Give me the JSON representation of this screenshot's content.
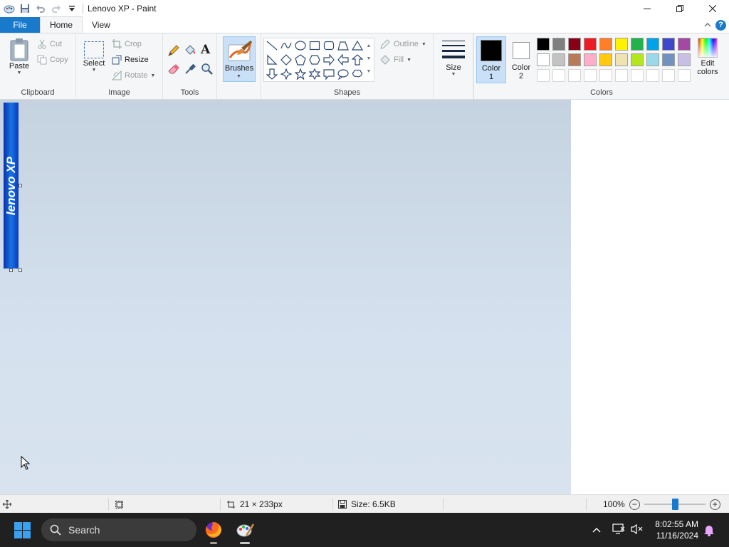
{
  "window": {
    "title": "Lenovo XP - Paint"
  },
  "tabs": {
    "file": "File",
    "home": "Home",
    "view": "View"
  },
  "ribbon": {
    "clipboard": {
      "label": "Clipboard",
      "paste": "Paste",
      "cut": "Cut",
      "copy": "Copy"
    },
    "image": {
      "label": "Image",
      "select": "Select",
      "crop": "Crop",
      "resize": "Resize",
      "rotate": "Rotate"
    },
    "tools": {
      "label": "Tools"
    },
    "brushes": {
      "label": "Brushes"
    },
    "shapes": {
      "label": "Shapes",
      "outline": "Outline",
      "fill": "Fill"
    },
    "size": {
      "label": "Size"
    },
    "color1": {
      "label": "Color",
      "num": "1"
    },
    "color2": {
      "label": "Color",
      "num": "2"
    },
    "colors": {
      "label": "Colors",
      "edit1": "Edit",
      "edit2": "colors",
      "row1": [
        "#000000",
        "#7f7f7f",
        "#880015",
        "#ed1c24",
        "#ff7f27",
        "#fff200",
        "#22b14c",
        "#00a2e8",
        "#3f48cc",
        "#a349a4"
      ],
      "row2": [
        "#ffffff",
        "#c3c3c3",
        "#b97a57",
        "#ffaec9",
        "#ffc90e",
        "#efe4b0",
        "#b5e61d",
        "#99d9ea",
        "#7092be",
        "#c8bfe7"
      ],
      "selected_color1": "#000000",
      "selected_color2": "#ffffff"
    }
  },
  "canvas": {
    "logo_text": "lenovo XP"
  },
  "status": {
    "selection_size": "21 × 233px",
    "file_size": "Size: 6.5KB",
    "zoom": "100%",
    "zoom_level": 1.0
  },
  "taskbar": {
    "search_placeholder": "Search",
    "time": "8:02:55 AM",
    "date": "11/16/2024"
  }
}
